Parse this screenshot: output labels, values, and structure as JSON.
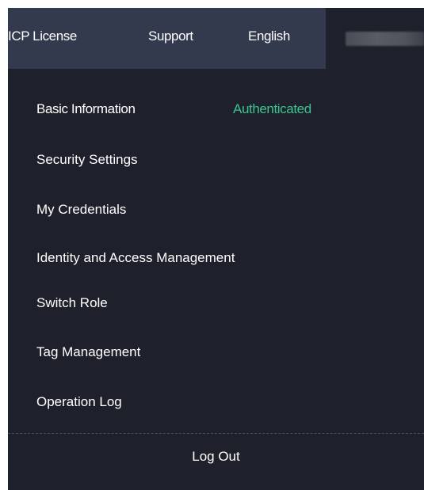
{
  "topbar": {
    "nav": {
      "icp_license": "ICP License",
      "support": "Support",
      "language": "English"
    },
    "account_name_obscured": true
  },
  "menu": {
    "basic_information": "Basic Information",
    "authentication_status": "Authenticated",
    "security_settings": "Security Settings",
    "my_credentials": "My Credentials",
    "identity_and_access_management": "Identity and Access Management",
    "switch_role": "Switch Role",
    "tag_management": "Tag Management",
    "operation_log": "Operation Log",
    "log_out": "Log Out"
  },
  "colors": {
    "panel_background": "#1e212b",
    "nav_highlight": "#333a4e",
    "status_green": "#3ec28f",
    "text": "#ffffff"
  }
}
